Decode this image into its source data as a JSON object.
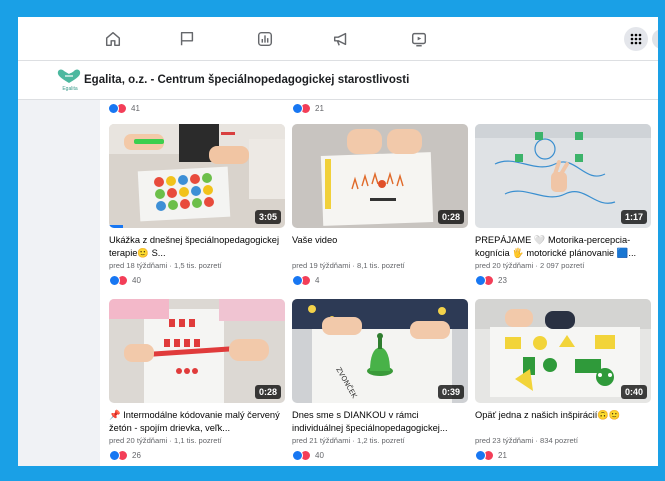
{
  "header": {
    "page_name": "Egalita, o.z. - Centrum špeciálnopedagogickej starostlivosti",
    "logo_text": "Egalita"
  },
  "nav": {
    "icons": [
      "home-icon",
      "flag-icon",
      "analytics-icon",
      "megaphone-icon",
      "video-icon"
    ],
    "menu_icon": "grid-menu-icon"
  },
  "top_row_counts": [
    "41",
    "21"
  ],
  "colors": {
    "accent": "#1877f2",
    "love": "#f33e58",
    "frame": "#1aa0e6"
  },
  "videos": [
    {
      "title": "Ukážka z dnešnej špeciálnopedagogickej terapie🙂 S...",
      "meta": "pred 18 týždňami · 1,5 tis. pozretí",
      "duration": "3:05",
      "reactions": "40",
      "progress": 0.08
    },
    {
      "title": "Vaše video",
      "meta": "pred 19 týždňami · 8,1 tis. pozretí",
      "duration": "0:28",
      "reactions": "4",
      "progress": 0
    },
    {
      "title": "PREPÁJAME 🤍 Motorika-percepcia-kognícia 🖐 motorické plánovanie 🟦...",
      "meta": "pred 20 týždňami · 2 097 pozretí",
      "duration": "1:17",
      "reactions": "23",
      "progress": 0
    },
    {
      "title": "📌 Intermodálne kódovanie malý červený žetón - spojím drievka, veľk...",
      "meta": "pred 20 týždňami · 1,1 tis. pozretí",
      "duration": "0:28",
      "reactions": "26",
      "progress": 0
    },
    {
      "title": "Dnes sme s DIANKOU v rámci individuálnej špeciálnopedagogickej...",
      "meta": "pred 21 týždňami · 1,2 tis. pozretí",
      "duration": "0:39",
      "reactions": "40",
      "progress": 0
    },
    {
      "title": "Opäť jedna z našich inšpirácií🙃🙂",
      "meta": "pred 23 týždňami · 834 pozretí",
      "duration": "0:40",
      "reactions": "21",
      "progress": 0
    }
  ]
}
